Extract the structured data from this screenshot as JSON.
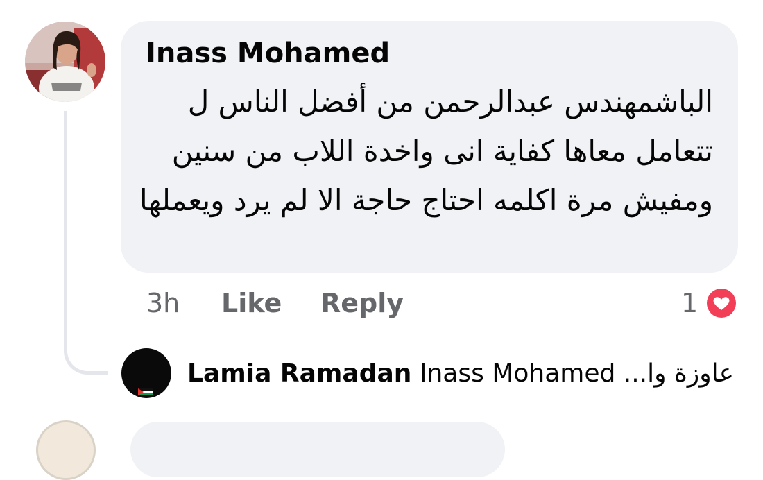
{
  "comment": {
    "author": "Inass Mohamed",
    "text": "الباشمهندس عبدالرحمن من أفضل الناس ل تتعامل معاها كفاية انى واخدة اللاب من سنين ومفيش مرة اكلمه احتاج حاجة الا لم يرد ويعملها",
    "time": "3h",
    "like_label": "Like",
    "reply_label": "Reply",
    "reaction_count": "1",
    "reaction_icon": "heart-icon",
    "reaction_color": "#f33e58"
  },
  "reply": {
    "author": "Lamia Ramadan",
    "preview": "Inass Mohamed ...عاوزة وا"
  },
  "colors": {
    "bubble": "#f0f2f5",
    "meta_text": "#65676b",
    "thread_line": "#e4e6eb"
  }
}
